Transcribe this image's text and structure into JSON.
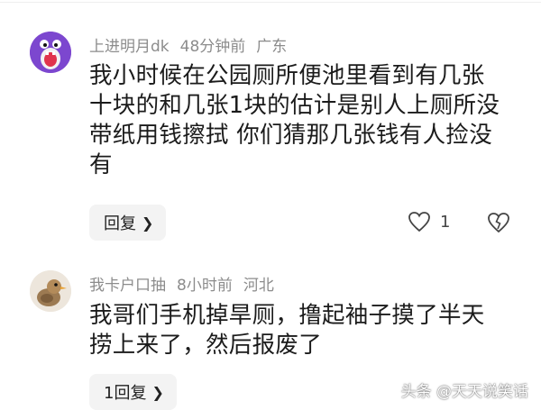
{
  "comments": [
    {
      "username": "上进明月dk",
      "time": "48分钟前",
      "location": "广东",
      "lines": [
        "我小时候在公园厕所便池里看到有几张",
        "十块的和几张1块的估计是别人上厕所没",
        "带纸用钱擦拭 你们猜那几张钱有人捡没",
        "有"
      ],
      "reply_label": "回复",
      "like_count": "1",
      "avatar_icon": "cartoon-face-avatar"
    },
    {
      "username": "我卡户口抽",
      "time": "8小时前",
      "location": "河北",
      "lines": [
        "我哥们手机掉旱厕，撸起袖子摸了半天",
        "捞上来了，然后报废了"
      ],
      "reply_label": "1回复",
      "avatar_icon": "bird-avatar"
    }
  ],
  "watermark": "头条 @天天说笑话",
  "colors": {
    "meta": "#8c8c8c",
    "button_bg": "#f3f3f3",
    "text": "#1b1b1b"
  }
}
